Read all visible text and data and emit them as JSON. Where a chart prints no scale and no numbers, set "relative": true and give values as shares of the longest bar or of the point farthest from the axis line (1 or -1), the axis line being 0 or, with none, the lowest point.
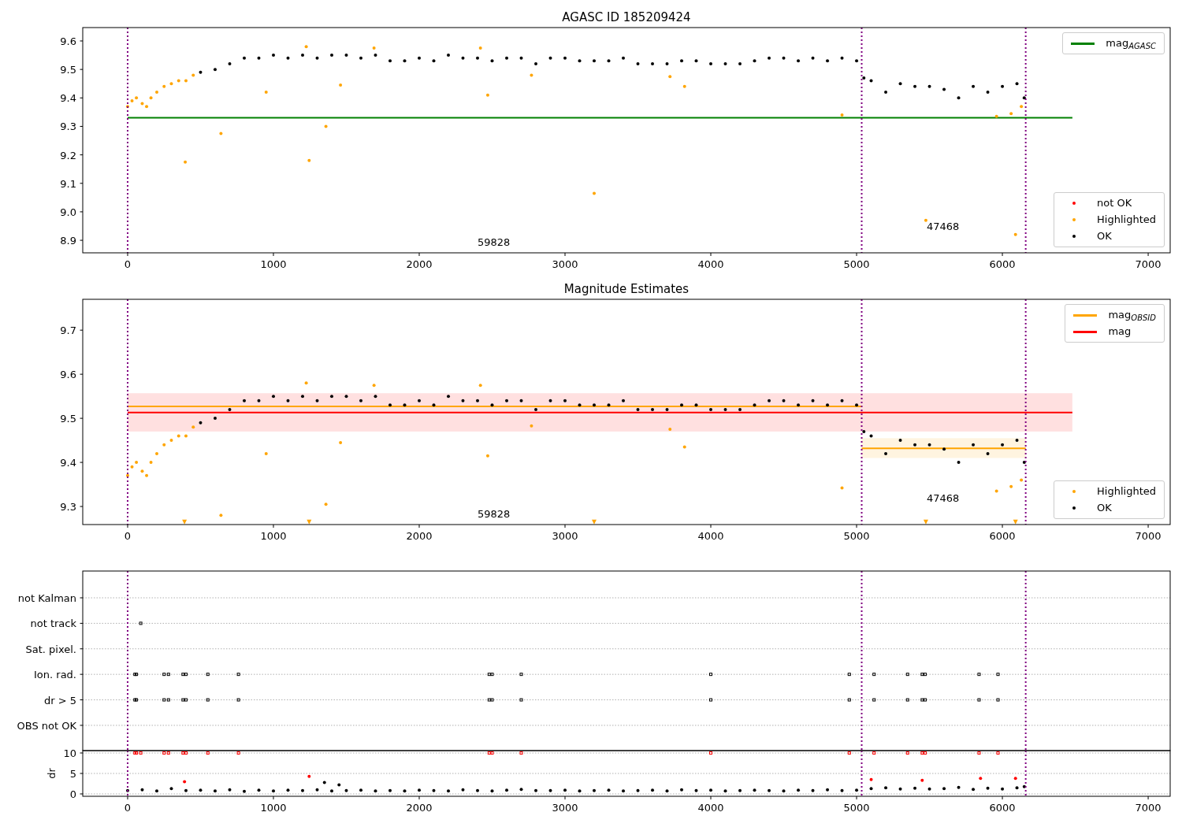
{
  "charts": [
    {
      "chart_data": {
        "type": "scatter",
        "title": "AGASC ID 185209424",
        "legend": "right",
        "xlim": [
          -308,
          7151
        ],
        "ylim": [
          8.856,
          9.647
        ],
        "xticks": [
          0,
          1000,
          2000,
          3000,
          4000,
          5000,
          6000,
          7000
        ],
        "yticks": [
          8.9,
          {
            "value": 9,
            "label": "9.0"
          },
          9.1,
          9.2,
          9.3,
          9.4,
          9.5,
          9.6
        ],
        "series": [
          {
            "name": "mag$_{AGASC}$",
            "type": "line",
            "color": "#008000",
            "x": [
              0,
              6480
            ],
            "values": [
              9.33,
              9.33
            ]
          },
          {
            "name": "not OK",
            "color": "#ff0000"
          },
          {
            "name": "Highlighted",
            "color": "#ffa500",
            "x": [
              0,
              30,
              60,
              100,
              130,
              160,
              200,
              250,
              300,
              350,
              400,
              450,
              395,
              640,
              950,
              1225,
              1245,
              1360,
              1460,
              1690,
              2420,
              2470,
              2770,
              3200,
              3720,
              3820,
              4900,
              5475,
              5960,
              6060,
              6090,
              6130
            ],
            "values": [
              9.37,
              9.39,
              9.4,
              9.38,
              9.37,
              9.4,
              9.42,
              9.44,
              9.45,
              9.46,
              9.46,
              9.48,
              9.175,
              9.275,
              9.42,
              9.58,
              9.18,
              9.3,
              9.445,
              9.575,
              9.575,
              9.41,
              9.48,
              9.065,
              9.475,
              9.44,
              9.34,
              8.97,
              9.335,
              9.345,
              8.92,
              9.37
            ]
          },
          {
            "name": "OK",
            "color": "#000000",
            "x": [
              500,
              600,
              700,
              800,
              900,
              1000,
              1100,
              1200,
              1300,
              1400,
              1500,
              1600,
              1700,
              1800,
              1900,
              2000,
              2100,
              2200,
              2300,
              2400,
              2500,
              2600,
              2700,
              2800,
              2900,
              3000,
              3100,
              3200,
              3300,
              3400,
              3500,
              3600,
              3700,
              3800,
              3900,
              4000,
              4100,
              4200,
              4300,
              4400,
              4500,
              4600,
              4700,
              4800,
              4900,
              5000,
              5050,
              5100,
              5200,
              5300,
              5400,
              5500,
              5600,
              5700,
              5800,
              5900,
              6000,
              6100,
              6150
            ],
            "values": [
              9.49,
              9.5,
              9.52,
              9.54,
              9.54,
              9.55,
              9.54,
              9.55,
              9.54,
              9.55,
              9.55,
              9.54,
              9.55,
              9.53,
              9.53,
              9.54,
              9.53,
              9.55,
              9.54,
              9.54,
              9.53,
              9.54,
              9.54,
              9.52,
              9.54,
              9.54,
              9.53,
              9.53,
              9.53,
              9.54,
              9.52,
              9.52,
              9.52,
              9.53,
              9.53,
              9.52,
              9.52,
              9.52,
              9.53,
              9.54,
              9.54,
              9.53,
              9.54,
              9.53,
              9.54,
              9.53,
              9.47,
              9.46,
              9.42,
              9.45,
              9.44,
              9.44,
              9.43,
              9.4,
              9.44,
              9.42,
              9.44,
              9.45,
              9.4
            ]
          }
        ],
        "ref_lines": [
          {
            "axis": "x",
            "value": 0,
            "color": "#800080"
          },
          {
            "axis": "x",
            "value": 5035,
            "color": "#800080"
          },
          {
            "axis": "x",
            "value": 6160,
            "color": "#800080"
          }
        ],
        "annotations": [
          "59828",
          "47468"
        ]
      }
    },
    {
      "chart_data": {
        "type": "scatter",
        "title": "Magnitude Estimates",
        "legend": "right",
        "xlim": [
          -308,
          7151
        ],
        "ylim": [
          9.259,
          9.77
        ],
        "xticks": [
          0,
          1000,
          2000,
          3000,
          4000,
          5000,
          6000,
          7000
        ],
        "yticks": [
          9.3,
          9.4,
          9.5,
          9.6,
          9.7
        ],
        "series": [
          {
            "name": "mag$_{OBSID}$",
            "type": "line",
            "color": "#ffa500",
            "x": [
              0,
              5035
            ],
            "values": [
              9.527,
              9.527
            ]
          },
          {
            "type": "line",
            "color": "#ffa500",
            "x": [
              5035,
              6160
            ],
            "values": [
              9.432,
              9.432
            ]
          },
          {
            "name": "mag",
            "type": "line",
            "color": "#ff0000",
            "x": [
              0,
              6480
            ],
            "values": [
              9.513,
              9.513
            ]
          },
          {
            "name": "Highlighted",
            "color": "#ffa500",
            "x": [
              0,
              30,
              60,
              100,
              130,
              160,
              200,
              250,
              300,
              350,
              400,
              450,
              640,
              950,
              1225,
              1360,
              1460,
              1690,
              2420,
              2470,
              2770,
              3720,
              3820,
              4900,
              5960,
              6060,
              6130
            ],
            "values": [
              9.37,
              9.39,
              9.4,
              9.38,
              9.37,
              9.4,
              9.42,
              9.44,
              9.45,
              9.46,
              9.46,
              9.48,
              9.28,
              9.42,
              9.58,
              9.305,
              9.445,
              9.575,
              9.575,
              9.415,
              9.483,
              9.475,
              9.435,
              9.342,
              9.335,
              9.345,
              9.36
            ]
          },
          {
            "name": "OK",
            "color": "#000000",
            "x": [
              500,
              600,
              700,
              800,
              900,
              1000,
              1100,
              1200,
              1300,
              1400,
              1500,
              1600,
              1700,
              1800,
              1900,
              2000,
              2100,
              2200,
              2300,
              2400,
              2500,
              2600,
              2700,
              2800,
              2900,
              3000,
              3100,
              3200,
              3300,
              3400,
              3500,
              3600,
              3700,
              3800,
              3900,
              4000,
              4100,
              4200,
              4300,
              4400,
              4500,
              4600,
              4700,
              4800,
              4900,
              5000,
              5050,
              5100,
              5200,
              5300,
              5400,
              5500,
              5600,
              5700,
              5800,
              5900,
              6000,
              6100,
              6150
            ],
            "values": [
              9.49,
              9.5,
              9.52,
              9.54,
              9.54,
              9.55,
              9.54,
              9.55,
              9.54,
              9.55,
              9.55,
              9.54,
              9.55,
              9.53,
              9.53,
              9.54,
              9.53,
              9.55,
              9.54,
              9.54,
              9.53,
              9.54,
              9.54,
              9.52,
              9.54,
              9.54,
              9.53,
              9.53,
              9.53,
              9.54,
              9.52,
              9.52,
              9.52,
              9.53,
              9.53,
              9.52,
              9.52,
              9.52,
              9.53,
              9.54,
              9.54,
              9.53,
              9.54,
              9.53,
              9.54,
              9.53,
              9.47,
              9.46,
              9.42,
              9.45,
              9.44,
              9.44,
              9.43,
              9.4,
              9.44,
              9.42,
              9.44,
              9.45,
              9.4
            ]
          },
          {
            "marker": "v",
            "color": "#ffa500",
            "x": [
              390,
              1245,
              3200,
              5475,
              6090
            ],
            "values": [
              9.265,
              9.265,
              9.265,
              9.265,
              9.265
            ]
          }
        ],
        "ref_lines": [
          {
            "axis": "x",
            "value": 0,
            "color": "#800080"
          },
          {
            "axis": "x",
            "value": 5035,
            "color": "#800080"
          },
          {
            "axis": "x",
            "value": 6160,
            "color": "#800080"
          }
        ],
        "bands": [
          {
            "axis": "y",
            "from": 9.47,
            "to": 9.557,
            "color": "#ff0000"
          },
          {
            "axis": "y",
            "from": 9.41,
            "to": 9.455,
            "color": "#ffa500"
          }
        ],
        "annotations": [
          "59828",
          "47468"
        ]
      }
    },
    {
      "chart_data": {
        "type": "scatter",
        "relative": true,
        "xlim": [
          -308,
          7151
        ],
        "orientation": "horizontal",
        "categories": [
          "not Kalman",
          "not track",
          "Sat. pixel.",
          "Ion. rad.",
          "dr > 5",
          "OBS not OK"
        ],
        "series": [
          {
            "marker": "s",
            "color": "#000000",
            "values": [
              null,
              90,
              null,
              50,
              50,
              null
            ]
          },
          {
            "marker": "s",
            "color": "#000000",
            "values": [
              null,
              null,
              null,
              60,
              60,
              null
            ]
          },
          {
            "marker": "s",
            "color": "#000000",
            "values": [
              null,
              null,
              null,
              250,
              250,
              null
            ]
          },
          {
            "marker": "s",
            "color": "#000000",
            "values": [
              null,
              null,
              null,
              280,
              280,
              null
            ]
          },
          {
            "marker": "s",
            "color": "#000000",
            "values": [
              null,
              null,
              null,
              380,
              380,
              null
            ]
          },
          {
            "marker": "s",
            "color": "#000000",
            "values": [
              null,
              null,
              null,
              400,
              400,
              null
            ]
          },
          {
            "marker": "s",
            "color": "#000000",
            "values": [
              null,
              null,
              null,
              550,
              550,
              null
            ]
          },
          {
            "marker": "s",
            "color": "#000000",
            "values": [
              null,
              null,
              null,
              760,
              760,
              null
            ]
          },
          {
            "marker": "s",
            "color": "#000000",
            "values": [
              null,
              null,
              null,
              2480,
              2480,
              null
            ]
          },
          {
            "marker": "s",
            "color": "#000000",
            "values": [
              null,
              null,
              null,
              2500,
              2500,
              null
            ]
          },
          {
            "marker": "s",
            "color": "#000000",
            "values": [
              null,
              null,
              null,
              2700,
              2700,
              null
            ]
          },
          {
            "marker": "s",
            "color": "#000000",
            "values": [
              null,
              null,
              null,
              4000,
              4000,
              null
            ]
          },
          {
            "marker": "s",
            "color": "#000000",
            "values": [
              null,
              null,
              null,
              4950,
              4950,
              null
            ]
          },
          {
            "marker": "s",
            "color": "#000000",
            "values": [
              null,
              null,
              null,
              5120,
              5120,
              null
            ]
          },
          {
            "marker": "s",
            "color": "#000000",
            "values": [
              null,
              null,
              null,
              5350,
              5350,
              null
            ]
          },
          {
            "marker": "s",
            "color": "#000000",
            "values": [
              null,
              null,
              null,
              5450,
              5450,
              null
            ]
          },
          {
            "marker": "s",
            "color": "#000000",
            "values": [
              null,
              null,
              null,
              5470,
              5470,
              null
            ]
          },
          {
            "marker": "s",
            "color": "#000000",
            "values": [
              null,
              null,
              null,
              5840,
              5840,
              null
            ]
          },
          {
            "marker": "s",
            "color": "#000000",
            "values": [
              null,
              null,
              null,
              5970,
              5970,
              null
            ]
          }
        ],
        "ref_lines": [
          {
            "axis": "x",
            "value": 0,
            "color": "#800080"
          },
          {
            "axis": "x",
            "value": 5035,
            "color": "#800080"
          },
          {
            "axis": "x",
            "value": 6160,
            "color": "#800080"
          }
        ]
      }
    },
    {
      "chart_data": {
        "type": "scatter",
        "grid": true,
        "ylabel": "dr",
        "xlim": [
          -308,
          7151
        ],
        "ylim": [
          -0.58,
          10.58
        ],
        "xticks": [
          0,
          1000,
          2000,
          3000,
          4000,
          5000,
          6000,
          7000
        ],
        "yticks": [
          0,
          5,
          10
        ],
        "series": [
          {
            "marker": "s",
            "color": "#ff0000",
            "x": [
              50,
              60,
              90,
              250,
              280,
              380,
              400,
              550,
              760,
              2480,
              2500,
              2700,
              4000,
              4950,
              5120,
              5350,
              5450,
              5470,
              5840,
              5970
            ],
            "values": [
              10,
              10,
              10,
              10,
              10,
              10,
              10,
              10,
              10,
              10,
              10,
              10,
              10,
              10,
              10,
              10,
              10,
              10,
              10,
              10
            ]
          },
          {
            "color": "#ff0000",
            "x": [
              390,
              1245,
              5100,
              5450,
              5850,
              6090
            ],
            "values": [
              3,
              4.3,
              3.5,
              3.3,
              3.8,
              3.8
            ]
          },
          {
            "color": "#000000",
            "x": [
              0,
              100,
              200,
              300,
              400,
              500,
              600,
              700,
              800,
              900,
              1000,
              1100,
              1200,
              1300,
              1350,
              1400,
              1450,
              1500,
              1600,
              1700,
              1800,
              1900,
              2000,
              2100,
              2200,
              2300,
              2400,
              2500,
              2600,
              2700,
              2800,
              2900,
              3000,
              3100,
              3200,
              3300,
              3400,
              3500,
              3600,
              3700,
              3800,
              3900,
              4000,
              4100,
              4200,
              4300,
              4400,
              4500,
              4600,
              4700,
              4800,
              4900,
              5000,
              5100,
              5200,
              5300,
              5400,
              5500,
              5600,
              5700,
              5800,
              5900,
              6000,
              6100,
              6150
            ],
            "values": [
              0.8,
              1.0,
              0.7,
              1.3,
              0.8,
              0.9,
              0.7,
              1.0,
              0.6,
              0.9,
              0.7,
              0.9,
              0.8,
              1.0,
              2.8,
              0.7,
              2.2,
              0.8,
              0.9,
              0.7,
              0.8,
              0.7,
              0.9,
              0.8,
              0.7,
              1.0,
              0.8,
              0.7,
              0.9,
              1.1,
              0.8,
              0.8,
              0.9,
              0.7,
              0.8,
              0.9,
              0.7,
              0.8,
              0.9,
              0.7,
              1.0,
              0.8,
              0.9,
              0.7,
              0.8,
              0.9,
              0.8,
              0.7,
              0.9,
              0.8,
              1.0,
              0.8,
              0.9,
              1.3,
              1.5,
              1.2,
              1.4,
              1.2,
              1.3,
              1.6,
              1.1,
              1.4,
              1.2,
              1.5,
              1.8
            ]
          }
        ],
        "ref_lines": [
          {
            "axis": "x",
            "value": 0,
            "color": "#800080"
          },
          {
            "axis": "x",
            "value": 5035,
            "color": "#800080"
          },
          {
            "axis": "x",
            "value": 6160,
            "color": "#800080"
          }
        ]
      }
    }
  ]
}
